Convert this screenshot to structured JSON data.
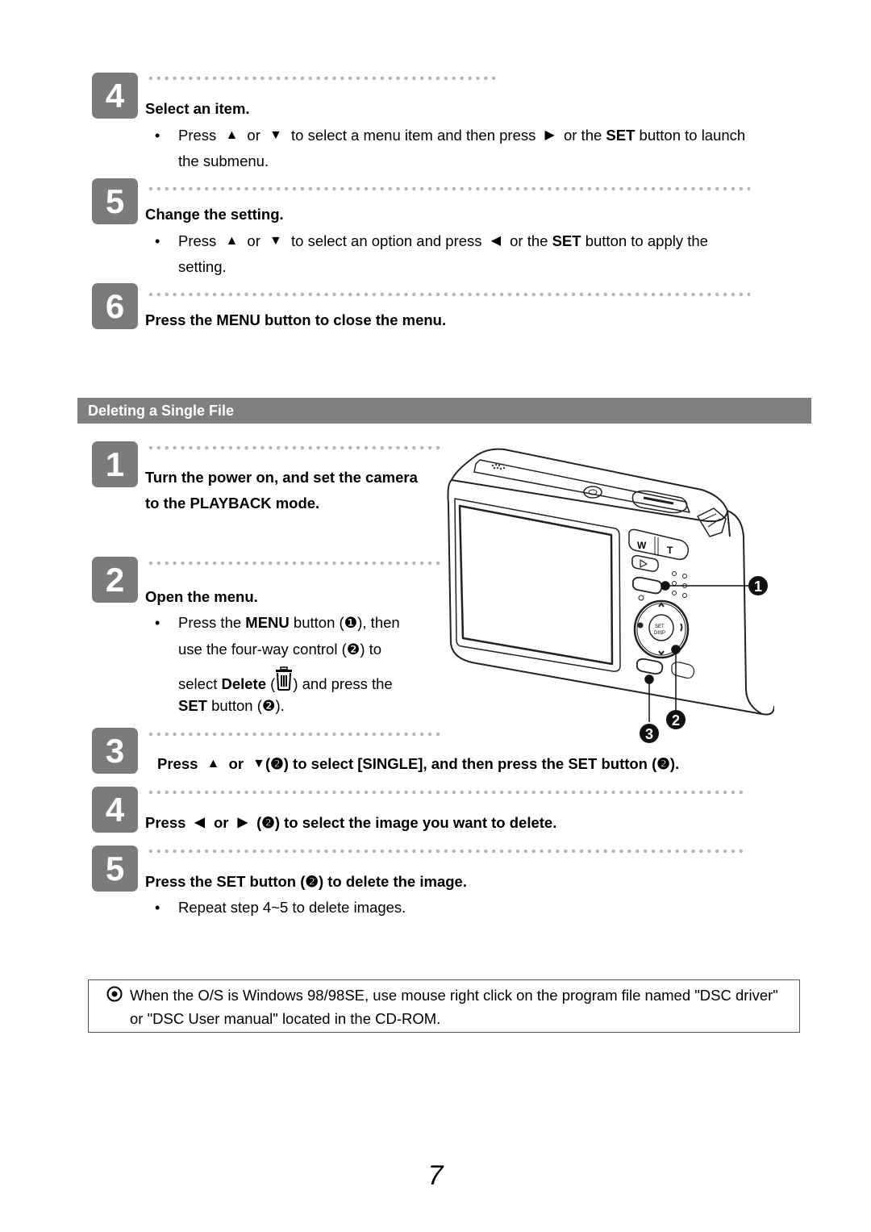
{
  "continued_steps": [
    {
      "number": "4",
      "title": "Select an item.",
      "bullet": {
        "pre": "Press",
        "up_icon": "▲",
        "or": "or",
        "down_icon": "▼",
        "mid": "to select a menu item and then press",
        "right_icon": "▶",
        "post1": "or the",
        "bold": "SET",
        "post2": "button to launch",
        "line2": "the submenu."
      }
    },
    {
      "number": "5",
      "title": "Change the setting.",
      "bullet": {
        "pre": "Press",
        "up_icon": "▲",
        "or": "or",
        "down_icon": "▼",
        "mid": "to select an option and press",
        "left_icon": "◀",
        "post1": "or the",
        "bold": "SET",
        "post2": "button to apply the",
        "line2": "setting."
      }
    },
    {
      "number": "6",
      "title": "Press the MENU button to close the menu."
    }
  ],
  "section": {
    "title": "Deleting a Single File"
  },
  "delete_steps": {
    "step1": {
      "number": "1",
      "line1": "Turn the power on, and set the camera",
      "line2": "to the PLAYBACK mode."
    },
    "step2": {
      "number": "2",
      "title": "Open the menu.",
      "l1_pre": "Press the",
      "l1_bold": "MENU",
      "l1_post": "button (❶), then",
      "l2": "use the four-way control (❷) to",
      "l3_pre": "select",
      "l3_bold": "Delete",
      "l3_open": "(",
      "l3_post": ") and press the",
      "l4_bold": "SET",
      "l4_post": "button (❷)."
    },
    "step3": {
      "number": "3",
      "pre": "Press",
      "up_icon": "▲",
      "or": "or",
      "down_icon": "▼",
      "post": "(❷) to select [SINGLE], and then press the SET button (❷)."
    },
    "step4": {
      "number": "4",
      "pre": "Press",
      "left_icon": "◀",
      "or": "or",
      "right_icon": "▶",
      "post": "(❷) to select the image you want to delete."
    },
    "step5": {
      "number": "5",
      "title": "Press the SET button (❷) to delete the image.",
      "bullet": "Repeat step 4~5 to delete images."
    }
  },
  "camera_figure": {
    "callouts": [
      "1",
      "2",
      "3"
    ],
    "zoom_w": "W",
    "zoom_t": "T",
    "set_label": "SET",
    "disp_label": "DISP"
  },
  "note": {
    "icon": "note-circle-dot-icon",
    "text": "When the O/S is Windows 98/98SE, use mouse right click on the program file named \"DSC driver\" or \"DSC User manual\" located in the CD-ROM."
  },
  "page_number": "7",
  "bullet_char": "•"
}
